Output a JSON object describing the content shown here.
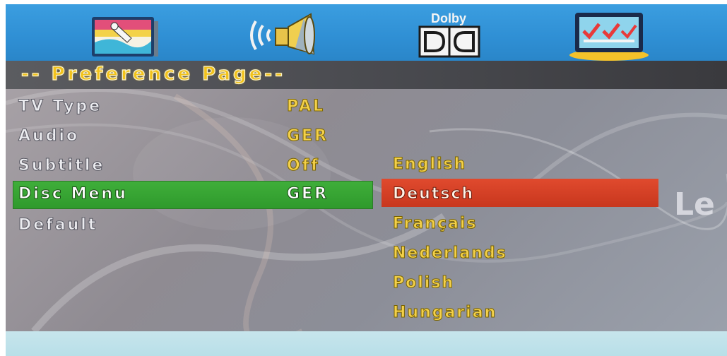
{
  "top_tabs": [
    {
      "id": "picture",
      "icon": "picture-setup-icon"
    },
    {
      "id": "audio",
      "icon": "speaker-icon"
    },
    {
      "id": "dolby",
      "icon": "dolby-digital-icon",
      "label": "Dolby"
    },
    {
      "id": "preference",
      "icon": "preference-checklist-icon"
    }
  ],
  "header": {
    "title": "-- Preference Page--"
  },
  "settings": [
    {
      "label": "TV Type",
      "value": "PAL"
    },
    {
      "label": "Audio",
      "value": "GER"
    },
    {
      "label": "Subtitle",
      "value": "Off"
    },
    {
      "label": "Disc Menu",
      "value": "GER",
      "selected": true
    },
    {
      "label": "Default",
      "value": ""
    }
  ],
  "language_options": [
    "English",
    "Deutsch",
    "Français",
    "Nederlands",
    "Polish",
    "Hungarian"
  ],
  "selected_language": "Deutsch",
  "watermark": "Le",
  "colors": {
    "topbar": "#2f8fd4",
    "header": "#4a4b50",
    "selected_row": "#3aa636",
    "selected_option": "#d4402a",
    "text_yellow": "#f4d14a",
    "bottom_strip": "#c0e3ea"
  }
}
